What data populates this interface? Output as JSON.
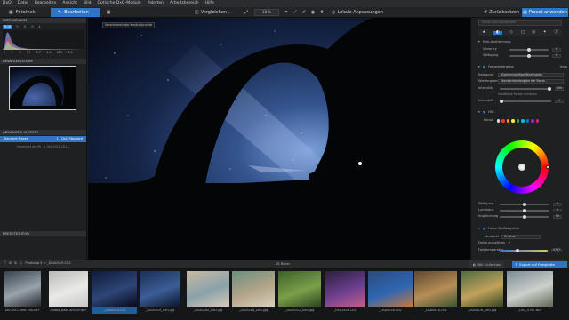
{
  "menubar": {
    "items": [
      "DxO",
      "Datei",
      "Bearbeiten",
      "Ansicht",
      "Bild",
      "Optische DxO-Module",
      "Paletten",
      "Arbeitsbereich",
      "Hilfe"
    ]
  },
  "toolbar": {
    "tab_library": "Fotothek",
    "tab_edit": "Bearbeiten",
    "compare": "Vergleichen",
    "zoom": "18 %",
    "local_adjust": "Lokale Anpassungen",
    "reset": "Zurücksetzen",
    "apply_preset": "Preset anwenden"
  },
  "left": {
    "histogram": "HISTOGRAMM",
    "channels": [
      "RGB",
      "R",
      "G",
      "B",
      "L"
    ],
    "hist_values": [
      "0",
      "17",
      "5.7",
      "1.4",
      "ISO",
      "3.2"
    ],
    "navigator": "BEWEGEN/ZOOM",
    "history": "ADVANCED HISTORY",
    "history_row": {
      "left": "Standard Preset",
      "right": "1 - DxO Standard"
    },
    "history_note": "Importiert am Mi., 6. Okt 2021 16:11",
    "preset_editor": "PRESETEDITOR"
  },
  "center": {
    "tooltip": "Verschieben der Kontrollpunkte"
  },
  "right": {
    "search_placeholder": "Suche nach Korrekturen",
    "section_hsl_adjust": "Farb-Abstimmung",
    "vibrancy": "Vibrancy",
    "saturation": "Sättigung",
    "vibrancy_val": "0",
    "saturation_val": "0",
    "color_rendering": "Farbwiedergabe",
    "auto": "Auto",
    "category_label": "Kategorie",
    "category_value": "Allgemeingültige Wiedergabe",
    "rendering_label": "Wiedergabe",
    "rendering_value": "Standardwiedergabe der Kame...",
    "intensity_label": "Intensität",
    "intensity_val": "100",
    "protect": "Gesättigte Farben schützen",
    "intensity2_label": "Intensität",
    "intensity2_val": "0",
    "hsl": "HSL",
    "channel_label": "Kanal",
    "sat_label": "Sättigung",
    "lum_label": "Luminanz",
    "mix_label": "Angleichung",
    "sat_val": "0",
    "lum_val": "0",
    "mix_val": "50",
    "wb": "Farbe Weißabgleich",
    "preset_label": "Auswahl",
    "preset_value": "Original",
    "picker_label": "Farbe auswählen",
    "temp_label": "Farbtemperatur",
    "temp_val": "2757",
    "channel_colors": [
      "#d9d9d9",
      "#e53935",
      "#ff9800",
      "#ffeb3b",
      "#43a047",
      "#00bcd4",
      "#1e63d6",
      "#9c27b0",
      "#e91e63"
    ]
  },
  "filmstrip_bar": {
    "folder": "Photolab 5 > _DSA0019.CR2",
    "count": "28 Bilder",
    "nik": "Nik Collection",
    "export": "Export auf Festplatte"
  },
  "thumbs": [
    {
      "name": "180705-Come-29A.NEF",
      "colors": [
        "#35414d",
        "#9aa3ab",
        "#20262c"
      ]
    },
    {
      "name": "Anaba_Base-arr039.NEF",
      "colors": [
        "#b9bab6",
        "#e9eae7",
        "#c6c7c3"
      ]
    },
    {
      "name": "_DSA0018.CR2",
      "colors": [
        "#0e1a3a",
        "#2e4677",
        "#060a18"
      ]
    },
    {
      "name": "_DSA0019_DxO.jpg",
      "colors": [
        "#1a2e55",
        "#3c5d97",
        "#0a1428"
      ]
    },
    {
      "name": "_DSA0280_DxO.jpg",
      "colors": [
        "#c9b9a4",
        "#8aa2a9",
        "#d7c9b8"
      ]
    },
    {
      "name": "_DSA0288_DxO.jpg",
      "colors": [
        "#6b8d7c",
        "#b4a58a",
        "#d9d0bd"
      ]
    },
    {
      "name": "_DSA0312_DxO.jpg",
      "colors": [
        "#3d5e2a",
        "#7aa04a",
        "#2d4420"
      ]
    },
    {
      "name": "_DSA1526.CR2",
      "colors": [
        "#2a1f3a",
        "#6c3f8f",
        "#c25f8a"
      ]
    },
    {
      "name": "_DSA0538.CR2",
      "colors": [
        "#2c4a7a",
        "#2f66b2",
        "#c47740"
      ]
    },
    {
      "name": "_DSA0678.CR2",
      "colors": [
        "#5b4830",
        "#b68d56",
        "#3e5430"
      ]
    },
    {
      "name": "_DSA0878_DxO.jpg",
      "colors": [
        "#4e6a3f",
        "#c1a25c",
        "#33451f"
      ]
    },
    {
      "name": "_DSC_0767.NEF",
      "colors": [
        "#7c8b94",
        "#cdd0cc",
        "#5d6a55"
      ]
    }
  ]
}
